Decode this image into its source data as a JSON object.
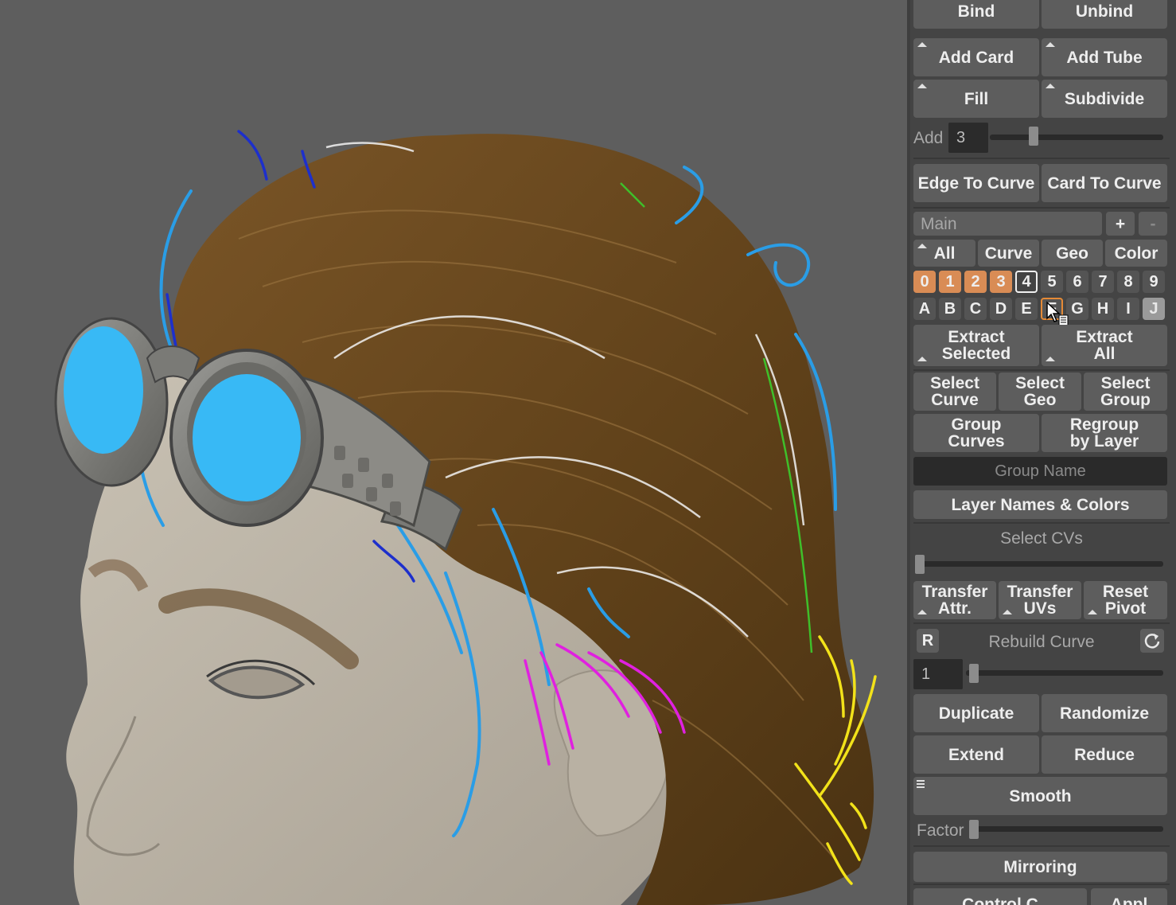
{
  "buttons": {
    "bind": "Bind",
    "unbind": "Unbind",
    "add_card": "Add Card",
    "add_tube": "Add Tube",
    "fill": "Fill",
    "subdivide": "Subdivide",
    "edge_to_curve": "Edge To Curve",
    "card_to_curve": "Card To Curve",
    "extract_selected": "Extract\nSelected",
    "extract_all": "Extract\nAll",
    "select_curve": "Select\nCurve",
    "select_geo": "Select\nGeo",
    "select_group": "Select\nGroup",
    "group_curves": "Group\nCurves",
    "regroup_by_layer": "Regroup\nby Layer",
    "layer_names_colors": "Layer Names & Colors",
    "transfer_attr": "Transfer\nAttr.",
    "transfer_uvs": "Transfer\nUVs",
    "reset_pivot": "Reset\nPivot",
    "duplicate": "Duplicate",
    "randomize": "Randomize",
    "extend": "Extend",
    "reduce": "Reduce",
    "smooth": "Smooth",
    "mirroring": "Mirroring",
    "control_curves_partial": "Control C",
    "apply_partial": "Appl"
  },
  "add": {
    "label": "Add",
    "value": "3",
    "slider_fraction": 0.25
  },
  "collection": {
    "name": "Main",
    "plus": "+",
    "minus": "-"
  },
  "filter_tabs": [
    "All",
    "Curve",
    "Geo",
    "Color"
  ],
  "layers_numeric": [
    {
      "label": "0",
      "state": "on"
    },
    {
      "label": "1",
      "state": "on"
    },
    {
      "label": "2",
      "state": "on"
    },
    {
      "label": "3",
      "state": "on"
    },
    {
      "label": "4",
      "state": "current"
    },
    {
      "label": "5",
      "state": "off"
    },
    {
      "label": "6",
      "state": "off"
    },
    {
      "label": "7",
      "state": "off"
    },
    {
      "label": "8",
      "state": "off"
    },
    {
      "label": "9",
      "state": "off"
    }
  ],
  "layers_alpha": [
    {
      "label": "A",
      "state": "off"
    },
    {
      "label": "B",
      "state": "off"
    },
    {
      "label": "C",
      "state": "off"
    },
    {
      "label": "D",
      "state": "off"
    },
    {
      "label": "E",
      "state": "off"
    },
    {
      "label": "F",
      "state": "selected"
    },
    {
      "label": "G",
      "state": "off"
    },
    {
      "label": "H",
      "state": "off"
    },
    {
      "label": "I",
      "state": "off"
    },
    {
      "label": "J",
      "state": "grey"
    }
  ],
  "group_name_placeholder": "Group Name",
  "select_cvs": {
    "label": "Select CVs",
    "slider_fraction": 0.0
  },
  "rebuild": {
    "r_label": "R",
    "label": "Rebuild Curve",
    "value": "1",
    "slider_fraction": 0.0
  },
  "smooth_factor": {
    "label": "Factor",
    "slider_fraction": 0.0
  },
  "colors": {
    "panel_bg": "#444444",
    "button_bg": "#5d5d5d",
    "layer_on": "#d98c55",
    "viewport_bg": "#5e5e5e",
    "lens": "#38b9f5",
    "hair_base": "#6b4a22"
  }
}
